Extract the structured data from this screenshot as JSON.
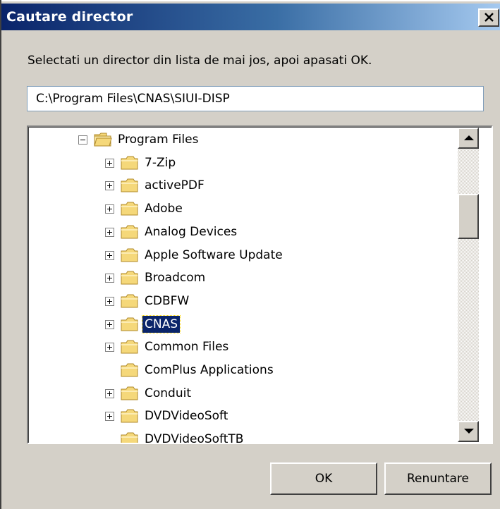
{
  "window": {
    "title": "Cautare director"
  },
  "instruction": "Selectati un director din lista de mai jos, apoi apasati OK.",
  "path_input": {
    "value": "C:\\Program Files\\CNAS\\SIUI-DISP"
  },
  "tree": {
    "items": [
      {
        "label": "Program Files",
        "level": 0,
        "expander": "minus",
        "selected": false,
        "icon": "open-folder-icon"
      },
      {
        "label": "7-Zip",
        "level": 1,
        "expander": "plus",
        "selected": false,
        "icon": "folder-icon"
      },
      {
        "label": "activePDF",
        "level": 1,
        "expander": "plus",
        "selected": false,
        "icon": "folder-icon"
      },
      {
        "label": "Adobe",
        "level": 1,
        "expander": "plus",
        "selected": false,
        "icon": "folder-icon"
      },
      {
        "label": "Analog Devices",
        "level": 1,
        "expander": "plus",
        "selected": false,
        "icon": "folder-icon"
      },
      {
        "label": "Apple Software Update",
        "level": 1,
        "expander": "plus",
        "selected": false,
        "icon": "folder-icon"
      },
      {
        "label": "Broadcom",
        "level": 1,
        "expander": "plus",
        "selected": false,
        "icon": "folder-icon"
      },
      {
        "label": "CDBFW",
        "level": 1,
        "expander": "plus",
        "selected": false,
        "icon": "folder-icon"
      },
      {
        "label": "CNAS",
        "level": 1,
        "expander": "plus",
        "selected": true,
        "icon": "folder-icon"
      },
      {
        "label": "Common Files",
        "level": 1,
        "expander": "plus",
        "selected": false,
        "icon": "folder-icon"
      },
      {
        "label": "ComPlus Applications",
        "level": 1,
        "expander": "none",
        "selected": false,
        "icon": "folder-icon"
      },
      {
        "label": "Conduit",
        "level": 1,
        "expander": "plus",
        "selected": false,
        "icon": "folder-icon"
      },
      {
        "label": "DVDVideoSoft",
        "level": 1,
        "expander": "plus",
        "selected": false,
        "icon": "folder-icon"
      },
      {
        "label": "DVDVideoSoftTB",
        "level": 1,
        "expander": "none",
        "selected": false,
        "icon": "folder-icon"
      }
    ]
  },
  "scrollbar": {
    "position": 0.2
  },
  "buttons": {
    "ok_label": "OK",
    "cancel_label": "Renuntare"
  },
  "colors": {
    "title_gradient_start": "#0a246a",
    "title_gradient_end": "#a6caf0",
    "selection": "#0a246a",
    "folder": "#f5d87a",
    "dialog_face": "#d4d0c8"
  }
}
